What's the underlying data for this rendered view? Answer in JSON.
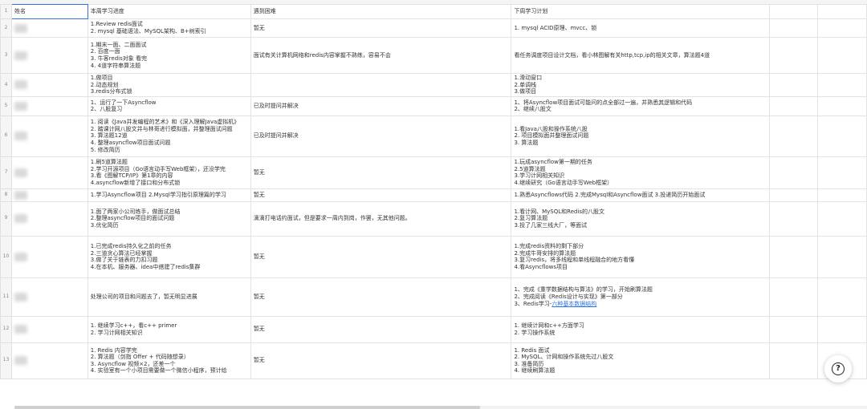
{
  "headers": {
    "row_num": "1",
    "name": "姓名",
    "progress": "本周学习进度",
    "problems": "遇到困难",
    "plan": "下周学习计划"
  },
  "rows": [
    {
      "num": "2",
      "progress": [
        "1.Review redis面试",
        "2. mysql 基础语法、MySQL架构、B+树索引"
      ],
      "problems": [
        "暂无"
      ],
      "plan": [
        "1. mysql ACID原理、mvcc、锁"
      ]
    },
    {
      "num": "3",
      "progress": [
        "1.期末一面、二面面试",
        "2. 百度一面",
        "3. 牛客redis对象 看完",
        "4. 4道字符串算法题"
      ],
      "problems": [
        "面试有关计算机网络和redis内容掌握不熟练，容易不会"
      ],
      "plan": [
        "看任务调度项目设计文档，看小林图解有关http,tcp,ip的相关文章，算法题4道"
      ]
    },
    {
      "num": "4",
      "progress": [
        "1.做项目",
        "2.动态规划",
        "3.redis分布式锁"
      ],
      "problems": [],
      "plan": [
        "1.滑动窗口",
        "2.单调栈",
        "3.做项目"
      ]
    },
    {
      "num": "5",
      "progress": [
        "1、运行了一下Asyncflow",
        "2、八股复习"
      ],
      "problems": [
        "已及时提问并解决"
      ],
      "plan": [
        "1、将Asyncflow项目面试可能问的点全部过一遍，并熟悉其逻辑和代码",
        "2、继续八股文"
      ]
    },
    {
      "num": "6",
      "progress": [
        "1. 阅读《Java并发编程的艺术》和《深入理解Java虚拟机》",
        "2. 踏课计网八股文并与林哥进行模拟面，并整理面试问题",
        "3. 算法题12道",
        "4. 整理asyncflow项目面试问题",
        "5. 修改简历"
      ],
      "problems": [
        "已及时提问并解决"
      ],
      "plan": [
        "1.看Java八股和操作系统八股",
        "2. 项目模拟面并整理面试问题",
        "3. 算法题"
      ]
    },
    {
      "num": "7",
      "progress": [
        "1.刷5道算法题",
        "2.学习开源项目（Go语言动手写Web框架），还没学完",
        "3.看《图解TCP/IP》第1章的内容",
        "4.asyncflow新增了接口和分布式锁"
      ],
      "problems": [
        "暂无"
      ],
      "plan": [
        "1.玩成asyncflow第一期的任务",
        "2.5道算法题",
        "3.学习计网相关知识",
        "4.继续研究（Go语言动手写Web框架）"
      ]
    },
    {
      "num": "8",
      "progress": [
        "1.学习Asyncflow项目 2.Mysql学习指引原理篇的学习"
      ],
      "problems": [
        "暂无"
      ],
      "plan": [
        "1.熟悉Asyncflows代码 2.完成Mysql和Asyncflow面试 3.投递简历开始面试"
      ]
    },
    {
      "num": "9",
      "progress": [
        "1.面了两家小公司练手，做面试总结",
        "2.整理asyncflow项目的面试问题",
        "3.优化简历"
      ],
      "problems": [
        "滴滴打电话约面试，但是要求一周内到岗，作罢，无其他问题。"
      ],
      "plan": [
        "1.看计网、MySQL和Redis的八股文",
        "2.复习算法题",
        "3.投了几家三线大厂，等面试"
      ]
    },
    {
      "num": "10",
      "progress": [
        "1.已完成redis持久化之前的任务",
        "2.三道贪心算法已经掌握",
        "3.做了关于链表的力扣习题",
        "4.在本机、服务器、idea中搭建了redis集群"
      ],
      "problems": [
        "暂无"
      ],
      "plan": [
        "1.完成redis资料的剩下部分",
        "2.完成牛哥安排的算法题",
        "3.复习redis，将多线程和单线程融合的地方看懂",
        "4.看Asyncflows项目"
      ]
    },
    {
      "num": "11",
      "progress": [
        "处理公司的项目和问题去了，暂无明显进展"
      ],
      "problems": [
        "暂无"
      ],
      "plan": [
        "1、完成《重学数据结构与算法》的学习，开始刷算法题",
        "2、完成阅读《Redis设计与实现》第一部分"
      ],
      "plan_link_prefix": "3、Redis学习-",
      "plan_link": "六种基本数据结构"
    },
    {
      "num": "12",
      "progress": [
        "1. 继续学习c++，看c++ primer",
        "2. 学习计网相关知识"
      ],
      "problems": [
        "暂无"
      ],
      "plan": [
        "1. 继续计网和c++方面学习",
        "2. 学习操作系统"
      ]
    },
    {
      "num": "13",
      "progress": [
        "1. Redis 内容学完",
        "2. 算法题（剑指 Offer + 代码随想录）",
        "3. Asyncflow 视频×2，还差一个",
        "4. 实验室有一个小项目需要做一个微信小程序，预计给"
      ],
      "problems": [
        "暂无"
      ],
      "plan": [
        "1. Redis 面试",
        "2. MySQL、计网和操作系统先过八股文",
        "3. 准备简历",
        "4. 继续刷算法题"
      ]
    }
  ],
  "icons": {
    "help": "help-icon"
  }
}
